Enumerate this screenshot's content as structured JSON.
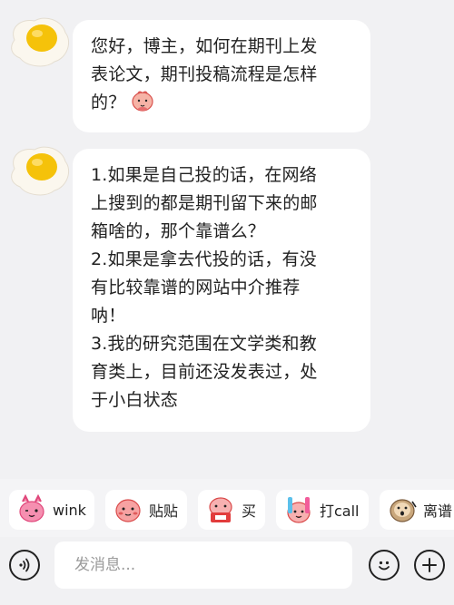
{
  "messages": [
    {
      "lines": [
        "您好，博主，如何在期刊上发",
        "表论文，期刊投稿流程是怎样",
        "的？"
      ],
      "avatar_icon": "fried-egg-icon",
      "inline_emoji": "shy-face-emoji-icon"
    },
    {
      "lines": [
        "1.如果是自己投的话，在网络",
        "上搜到的都是期刊留下来的邮",
        "箱啥的，那个靠谱么？",
        "2.如果是拿去代投的话，有没",
        "有比较靠谱的网站中介推荐",
        "呐！",
        "3.我的研究范围在文学类和教",
        "育类上，目前还没发表过，处",
        "于小白状态"
      ],
      "avatar_icon": "fried-egg-icon"
    }
  ],
  "sticker_bar": [
    {
      "label": "wink",
      "icon": "wink-sticker-icon"
    },
    {
      "label": "贴贴",
      "icon": "hug-sticker-icon"
    },
    {
      "label": "买",
      "icon": "buy-sticker-icon"
    },
    {
      "label": "打call",
      "icon": "cheer-sticker-icon"
    },
    {
      "label": "离谱",
      "icon": "shocked-sticker-icon"
    }
  ],
  "input": {
    "placeholder": "发消息..."
  },
  "colors": {
    "background": "#f1f1f3",
    "bubble": "#ffffff",
    "text": "#222222",
    "placeholder": "#9a9a9a",
    "egg_yolk": "#f5c20a"
  }
}
